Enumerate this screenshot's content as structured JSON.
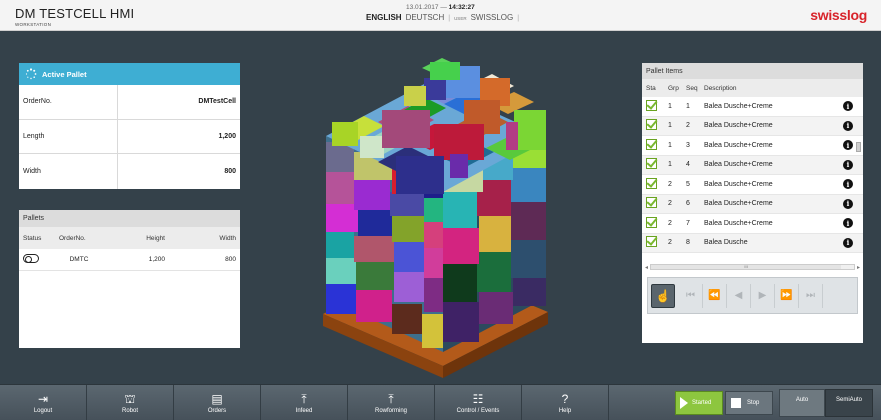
{
  "header": {
    "title": "DM TESTCELL HMI",
    "subtitle": "WORKSTATION",
    "date": "13.01.2017",
    "dash": "—",
    "time": "14:32:27",
    "lang_en": "ENGLISH",
    "lang_de": "DEUTSCH",
    "user_label": "USER",
    "user": "SWISSLOG",
    "brand": "swisslog"
  },
  "active_pallet": {
    "title": "Active Pallet",
    "rows": [
      {
        "label": "OrderNo.",
        "value": "DMTestCell"
      },
      {
        "label": "Length",
        "value": "1,200"
      },
      {
        "label": "Width",
        "value": "800"
      }
    ]
  },
  "pallets": {
    "title": "Pallets",
    "columns": [
      "Status",
      "OrderNo.",
      "Height",
      "Width"
    ],
    "rows": [
      {
        "order": "DMTC",
        "height": "1,200",
        "width": "800"
      }
    ]
  },
  "pallet_items": {
    "title": "Pallet Items",
    "columns": [
      "Sta",
      "Grp",
      "Seq",
      "Description"
    ],
    "rows": [
      {
        "grp": "1",
        "seq": "1",
        "desc": "Balea Dusche+Creme"
      },
      {
        "grp": "1",
        "seq": "2",
        "desc": "Balea Dusche+Creme"
      },
      {
        "grp": "1",
        "seq": "3",
        "desc": "Balea Dusche+Creme"
      },
      {
        "grp": "1",
        "seq": "4",
        "desc": "Balea Dusche+Creme"
      },
      {
        "grp": "2",
        "seq": "5",
        "desc": "Balea Dusche+Creme"
      },
      {
        "grp": "2",
        "seq": "6",
        "desc": "Balea Dusche+Creme"
      },
      {
        "grp": "2",
        "seq": "7",
        "desc": "Balea Dusche+Creme"
      },
      {
        "grp": "2",
        "seq": "8",
        "desc": "Balea Dusche"
      }
    ],
    "scroll_grip": "III"
  },
  "footer": {
    "buttons": [
      {
        "label": "Logout",
        "icon": "logout-icon"
      },
      {
        "label": "Robot",
        "icon": "robot-icon"
      },
      {
        "label": "Orders",
        "icon": "orders-icon"
      },
      {
        "label": "Infeed",
        "icon": "infeed-icon"
      },
      {
        "label": "Rowforming",
        "icon": "rowforming-icon"
      },
      {
        "label": "Control / Events",
        "icon": "sliders-icon"
      },
      {
        "label": "Help",
        "icon": "help-icon"
      }
    ],
    "started": "Started",
    "stop": "Stop",
    "auto": "Auto",
    "semiauto": "SemiAuto"
  },
  "colors": {
    "accent": "#3eaed3",
    "background": "#34414a",
    "started_green": "#8dc63f",
    "brand_red": "#d8232a"
  }
}
